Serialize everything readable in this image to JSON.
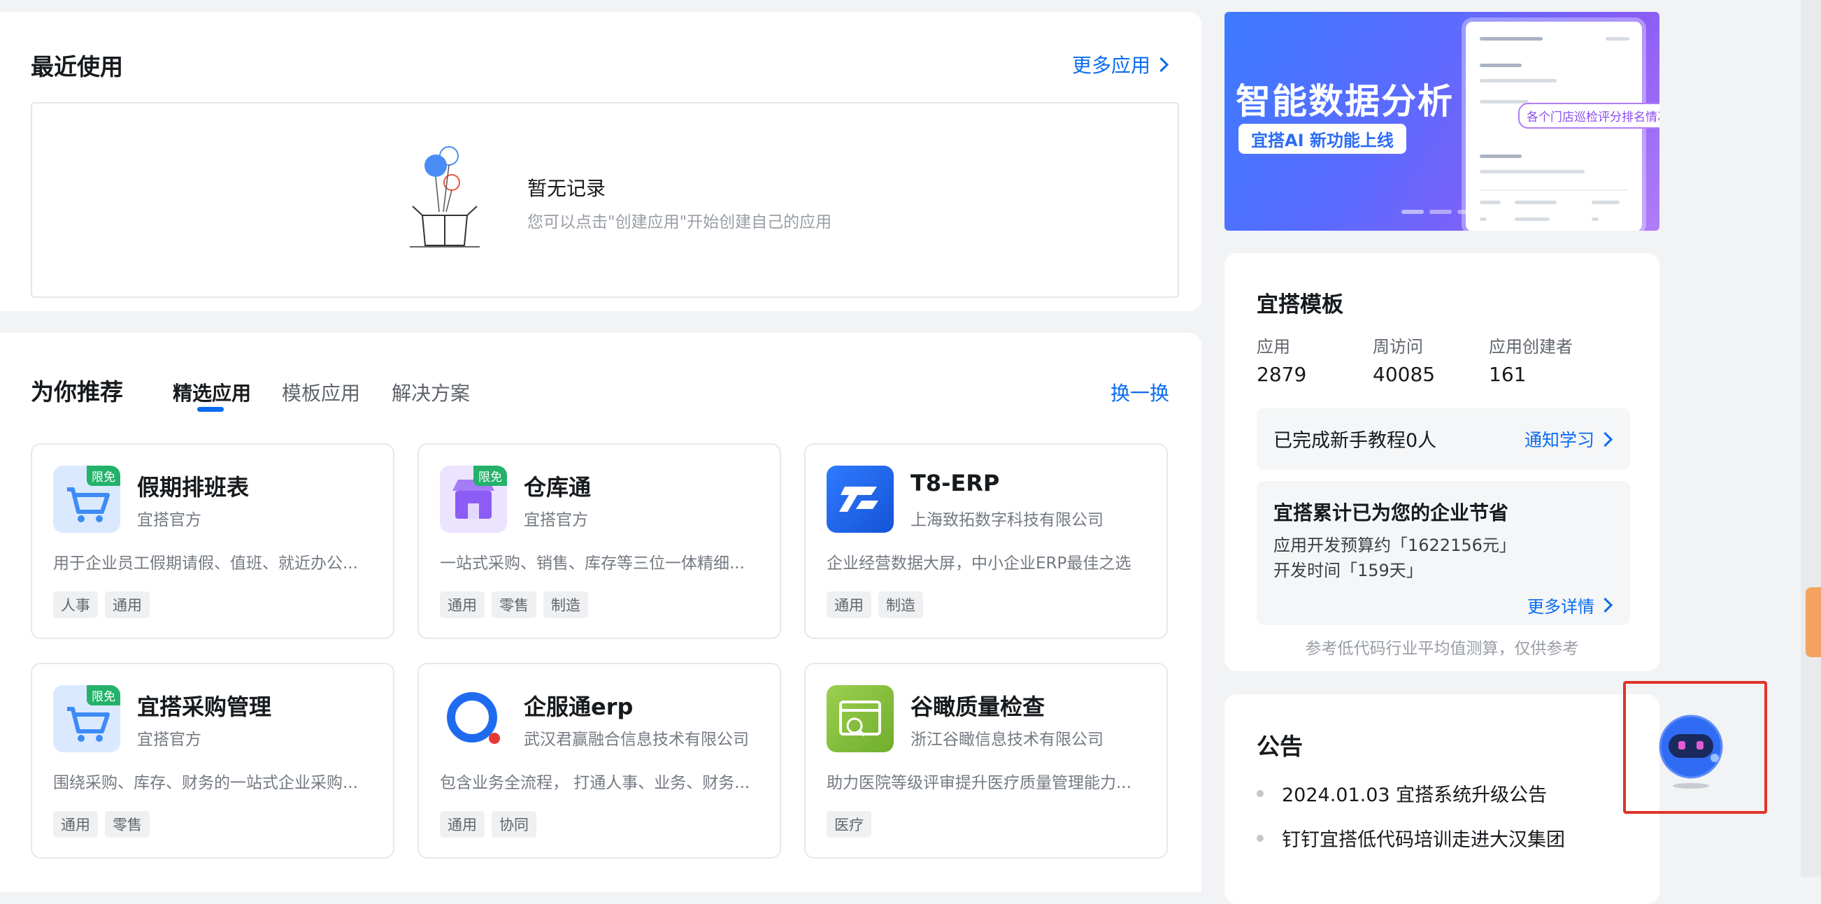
{
  "recent": {
    "title": "最近使用",
    "more_link": "更多应用",
    "empty_title": "暂无记录",
    "empty_desc": "您可以点击\"创建应用\"开始创建自己的应用"
  },
  "recommend": {
    "title": "为你推荐",
    "tabs": [
      "精选应用",
      "模板应用",
      "解决方案"
    ],
    "active_tab": "精选应用",
    "refresh_link": "换一换",
    "apps": [
      {
        "name": "假期排班表",
        "vendor": "宜搭官方",
        "desc": "用于企业员工假期请假、值班、就近办公...",
        "tags": [
          "人事",
          "通用"
        ],
        "badge": "限免",
        "icon": "shopping-cart-icon",
        "color": "#3d8bf5"
      },
      {
        "name": "仓库通",
        "vendor": "宜搭官方",
        "desc": "一站式采购、销售、库存等三位一体精细...",
        "tags": [
          "通用",
          "零售",
          "制造"
        ],
        "badge": "限免",
        "icon": "store-icon",
        "color": "#8b5cf6"
      },
      {
        "name": "T8-ERP",
        "vendor": "上海致拓数字科技有限公司",
        "desc": "企业经营数据大屏，中小企业ERP最佳之选",
        "tags": [
          "通用",
          "制造"
        ],
        "badge": "",
        "icon": "t8-logo-icon",
        "color": "#1f6bf0"
      },
      {
        "name": "宜搭采购管理",
        "vendor": "宜搭官方",
        "desc": "围绕采购、库存、财务的一站式企业采购...",
        "tags": [
          "通用",
          "零售"
        ],
        "badge": "限免",
        "icon": "shopping-cart-icon",
        "color": "#3d8bf5"
      },
      {
        "name": "企服通erp",
        "vendor": "武汉君赢融合信息技术有限公司",
        "desc": "包含业务全流程， 打通人事、业务、财务...",
        "tags": [
          "通用",
          "协同"
        ],
        "badge": "",
        "icon": "ring-logo-icon",
        "color": "#1f6bf0"
      },
      {
        "name": "谷瞰质量检查",
        "vendor": "浙江谷瞰信息技术有限公司",
        "desc": "助力医院等级评审提升医疗质量管理能力...",
        "tags": [
          "医疗"
        ],
        "badge": "",
        "icon": "quality-check-icon",
        "color": "#8cc43f"
      }
    ]
  },
  "banner": {
    "headline": "智能数据分析",
    "pill": "宜搭AI  新功能上线",
    "bubble": "各个门店巡检评分排名情况"
  },
  "template": {
    "title": "宜搭模板",
    "stats": [
      {
        "label": "应用",
        "value": "2879"
      },
      {
        "label": "周访问",
        "value": "40085"
      },
      {
        "label": "应用创建者",
        "value": "161"
      }
    ],
    "tutorial_text": "已完成新手教程0人",
    "tutorial_link": "通知学习",
    "saving_title": "宜搭累计已为您的企业节省",
    "saving_budget": "应用开发预算约「1622156元」",
    "saving_time": "开发时间「159天」",
    "saving_link": "更多详情",
    "footnote": "参考低代码行业平均值测算，仅供参考"
  },
  "notice": {
    "title": "公告",
    "items": [
      "2024.01.03 宜搭系统升级公告",
      "钉钉宜搭低代码培训走进大汉集团"
    ]
  },
  "colors": {
    "accent": "#0a6cf0",
    "badge": "#24b26b",
    "highlight_frame": "#e0332c"
  }
}
